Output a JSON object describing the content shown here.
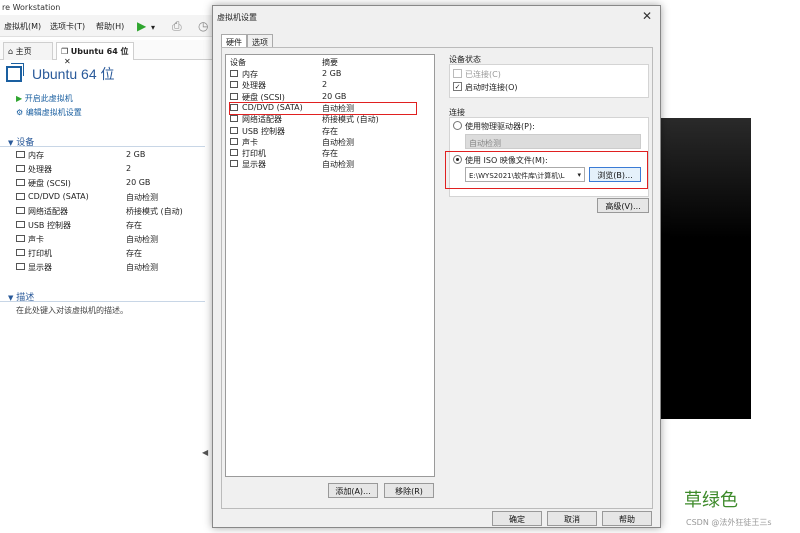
{
  "app": {
    "title": "re Workstation",
    "menu": [
      "虚拟机(M)",
      "选项卡(T)",
      "帮助(H)"
    ],
    "tabs": [
      "主页",
      "Ubuntu 64 位"
    ]
  },
  "vm": {
    "name": "Ubuntu 64 位",
    "actions": [
      "开启此虚拟机",
      "编辑虚拟机设置"
    ],
    "devices_heading": "设备",
    "devices": [
      {
        "name": "内存",
        "value": "2 GB",
        "icon": "memory-icon"
      },
      {
        "name": "处理器",
        "value": "2",
        "icon": "cpu-icon"
      },
      {
        "name": "硬盘 (SCSI)",
        "value": "20 GB",
        "icon": "disk-icon"
      },
      {
        "name": "CD/DVD (SATA)",
        "value": "自动检测",
        "icon": "cd-icon"
      },
      {
        "name": "网络适配器",
        "value": "桥接模式 (自动)",
        "icon": "network-icon"
      },
      {
        "name": "USB 控制器",
        "value": "存在",
        "icon": "usb-icon"
      },
      {
        "name": "声卡",
        "value": "自动检测",
        "icon": "sound-icon"
      },
      {
        "name": "打印机",
        "value": "存在",
        "icon": "printer-icon"
      },
      {
        "name": "显示器",
        "value": "自动检测",
        "icon": "display-icon"
      }
    ],
    "desc_heading": "描述",
    "desc_placeholder": "在此处键入对该虚拟机的描述。"
  },
  "dialog": {
    "title": "虚拟机设置",
    "close": "✕",
    "tabs": [
      "硬件",
      "选项"
    ],
    "list_headers": [
      "设备",
      "摘要"
    ],
    "devices": [
      {
        "name": "内存",
        "value": "2 GB"
      },
      {
        "name": "处理器",
        "value": "2"
      },
      {
        "name": "硬盘 (SCSI)",
        "value": "20 GB"
      },
      {
        "name": "CD/DVD (SATA)",
        "value": "自动检测"
      },
      {
        "name": "网络适配器",
        "value": "桥接模式 (自动)"
      },
      {
        "name": "USB 控制器",
        "value": "存在"
      },
      {
        "name": "声卡",
        "value": "自动检测"
      },
      {
        "name": "打印机",
        "value": "存在"
      },
      {
        "name": "显示器",
        "value": "自动检测"
      }
    ],
    "add_button": "添加(A)...",
    "remove_button": "移除(R)",
    "device_status_label": "设备状态",
    "connected_label": "已连接(C)",
    "connect_on_start_label": "启动时连接(O)",
    "connection_label": "连接",
    "physical_drive_label": "使用物理驱动器(P):",
    "physical_drive_value": "自动检测",
    "iso_label": "使用 ISO 映像文件(M):",
    "iso_path": "E:\\WYS2021\\软件库\\计算机\\L",
    "browse_button": "浏览(B)...",
    "advanced_button": "高级(V)...",
    "ok_button": "确定",
    "cancel_button": "取消",
    "help_button": "帮助"
  },
  "watermark": "草绿色",
  "csdn": "CSDN @法外狂徒王三s",
  "colors": {
    "accent": "#2a5a9a",
    "highlight": "#e02020",
    "watermark": "#3d8a2a"
  }
}
